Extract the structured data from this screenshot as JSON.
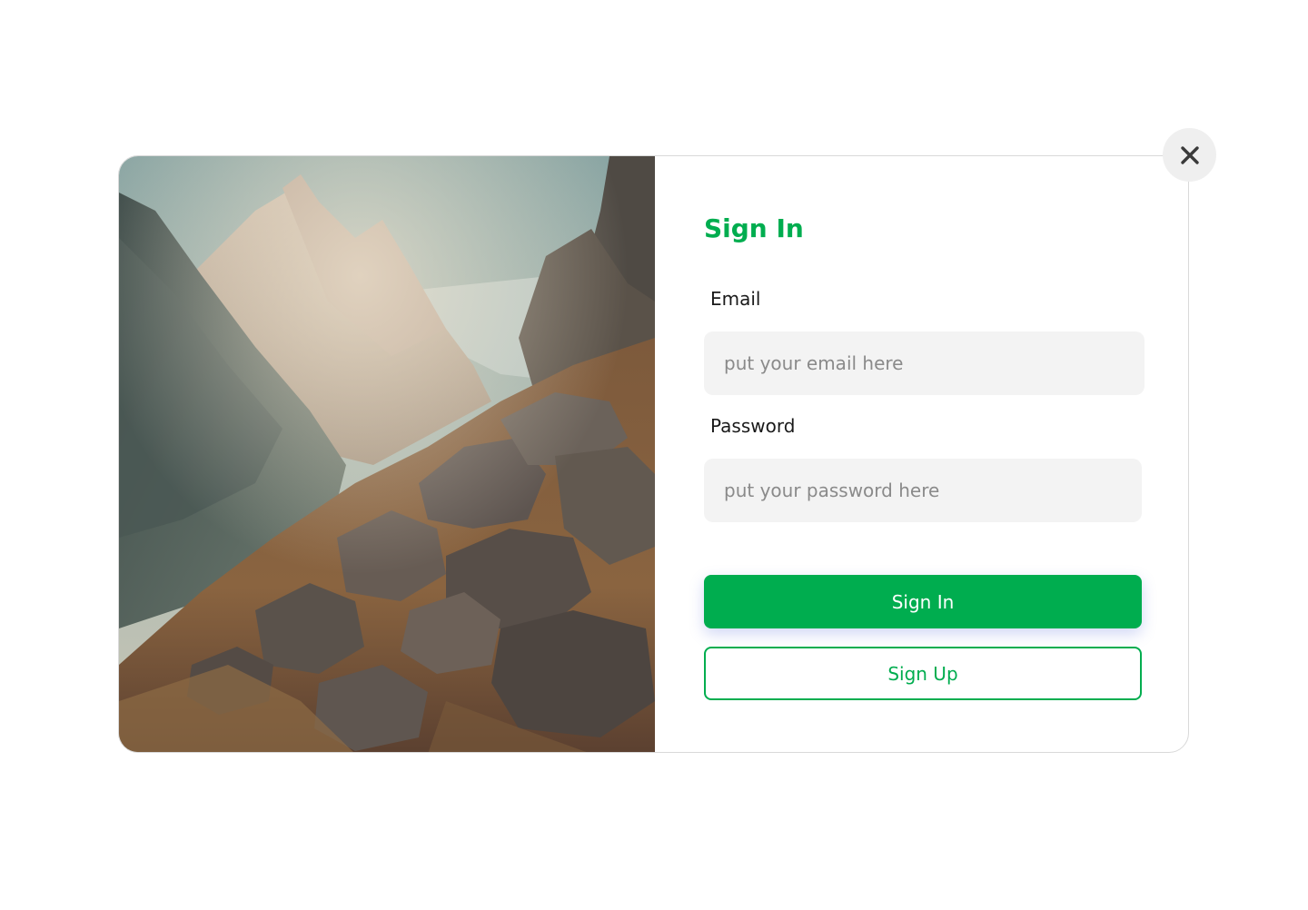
{
  "modal": {
    "title": "Sign In",
    "email": {
      "label": "Email",
      "value": "",
      "placeholder": "put your email here"
    },
    "password": {
      "label": "Password",
      "value": "",
      "placeholder": "put your password here"
    },
    "sign_in_label": "Sign In",
    "sign_up_label": "Sign Up",
    "close_icon": "close-icon",
    "image": "mountain-landscape-photo"
  },
  "colors": {
    "accent": "#00ad4f",
    "input_bg": "#f3f3f3",
    "close_bg": "#efefef",
    "border": "#d9d9d9"
  }
}
